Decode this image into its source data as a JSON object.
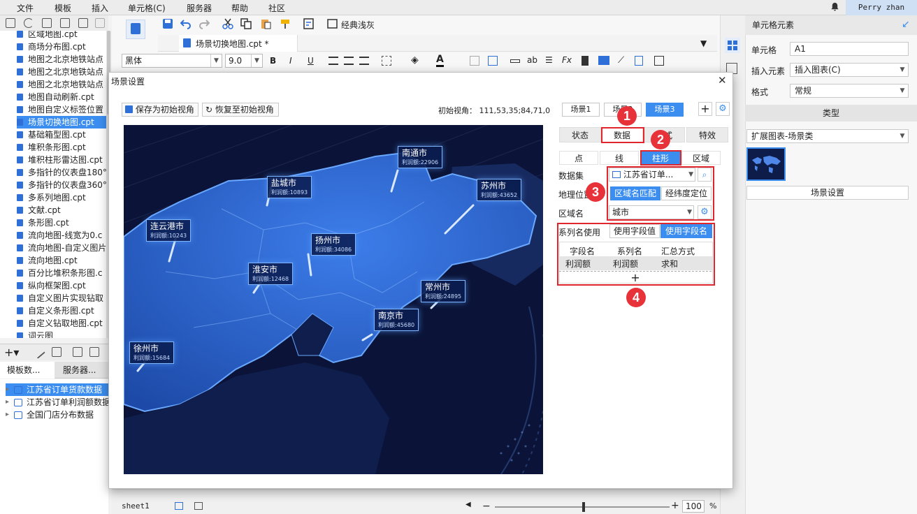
{
  "menu": [
    "文件",
    "模板",
    "插入",
    "单元格(C)",
    "服务器",
    "帮助",
    "社区"
  ],
  "user": "Perry zhan",
  "files": [
    {
      "label": "区域地图.cpt"
    },
    {
      "label": "商场分布图.cpt"
    },
    {
      "label": "地图之北京地铁站点"
    },
    {
      "label": "地图之北京地铁站点"
    },
    {
      "label": "地图之北京地铁站点"
    },
    {
      "label": "地图自动刷新.cpt"
    },
    {
      "label": "地图自定义标签位置"
    },
    {
      "label": "场景切换地图.cpt",
      "selected": true
    },
    {
      "label": "基础箱型图.cpt"
    },
    {
      "label": "堆积条形图.cpt"
    },
    {
      "label": "堆积柱形雷达图.cpt"
    },
    {
      "label": "多指针的仪表盘180°"
    },
    {
      "label": "多指针的仪表盘360°"
    },
    {
      "label": "多系列地图.cpt"
    },
    {
      "label": "文献.cpt"
    },
    {
      "label": "条形图.cpt"
    },
    {
      "label": "流向地图-线宽为0.c"
    },
    {
      "label": "流向地图-自定义图片"
    },
    {
      "label": "流向地图.cpt"
    },
    {
      "label": "百分比堆积条形图.c"
    },
    {
      "label": "纵向框架图.cpt"
    },
    {
      "label": "自定义图片实现钻取"
    },
    {
      "label": "自定义条形图.cpt"
    },
    {
      "label": "自定义钻取地图.cpt"
    },
    {
      "label": "词云图"
    }
  ],
  "panel_tabs": [
    "模板数...",
    "服务器..."
  ],
  "datasets": [
    {
      "label": "江苏省订单货款数据",
      "selected": true
    },
    {
      "label": "江苏省订单利润额数据"
    },
    {
      "label": "全国门店分布数据"
    }
  ],
  "toolbar": {
    "theme_label": "经典浅灰",
    "doc_tab": "场景切换地图.cpt *"
  },
  "format": {
    "font": "黑体",
    "size": "9.0"
  },
  "dialog": {
    "title": "场景设置",
    "save_view": "保存为初始视角",
    "restore_view": "恢复至初始视角",
    "init_view": "初始视角： 111,53,35;84,71,0",
    "scenes": [
      "场景1",
      "场景2",
      "场景3"
    ],
    "active_scene": 2
  },
  "map_labels": [
    {
      "name": "南通市",
      "value": "利润额:22906"
    },
    {
      "name": "盐城市",
      "value": "利润额:10893"
    },
    {
      "name": "苏州市",
      "value": "利润额:43652"
    },
    {
      "name": "连云港市",
      "value": "利润额:10243"
    },
    {
      "name": "扬州市",
      "value": "利润额:34086"
    },
    {
      "name": "淮安市",
      "value": "利润额:12468"
    },
    {
      "name": "常州市",
      "value": "利润额:24895"
    },
    {
      "name": "南京市",
      "value": "利润额:45680"
    },
    {
      "name": "徐州市",
      "value": "利润额:15684"
    }
  ],
  "props": {
    "tabs": [
      "状态",
      "数据",
      "样式",
      "特效"
    ],
    "subtabs": [
      "点",
      "线",
      "柱形",
      "区域"
    ],
    "dataset_label": "数据集",
    "dataset_value": "江苏省订单...",
    "geo_label": "地理位置",
    "geo_opt1": "区域名匹配",
    "geo_opt2": "经纬度定位",
    "region_label": "区域名",
    "region_value": "城市",
    "series_label": "系列名使用",
    "series_opt1": "使用字段值",
    "series_opt2": "使用字段名",
    "table_headers": [
      "字段名",
      "系列名",
      "汇总方式"
    ],
    "table_row": [
      "利润额",
      "利润额",
      "求和"
    ],
    "add_symbol": "+"
  },
  "badges": [
    "1",
    "2",
    "3",
    "4"
  ],
  "right_panel": {
    "header": "单元格元素",
    "cell_label": "单元格",
    "cell_value": "A1",
    "insert_label": "插入元素",
    "insert_value": "插入图表(C)",
    "format_label": "格式",
    "format_value": "常规",
    "type_header": "类型",
    "type_value": "扩展图表-场景类",
    "scene_button": "场景设置"
  },
  "bottom": {
    "sheet": "sheet1",
    "zoom": "100",
    "pct": "%"
  },
  "colors": {
    "accent": "#3b8ef0",
    "badge": "#e8323a",
    "highlight_box": "#e0252d",
    "map_bg": "#0b1438"
  }
}
